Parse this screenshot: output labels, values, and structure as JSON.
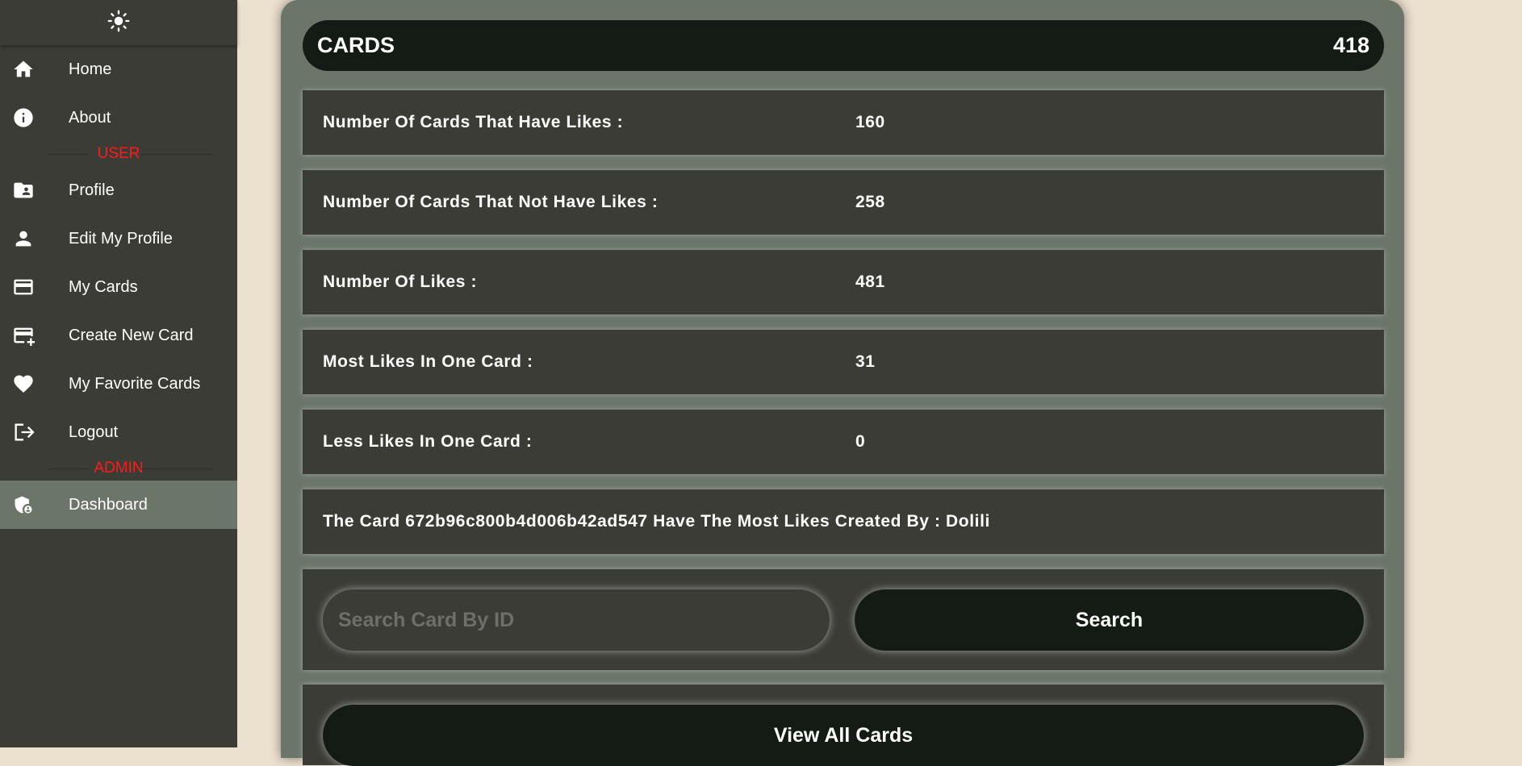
{
  "sidebar": {
    "theme_icon": "sun-icon",
    "items_user_top": [
      {
        "label": "Home",
        "icon": "home-icon"
      },
      {
        "label": "About",
        "icon": "info-icon"
      }
    ],
    "user_section_label": "USER",
    "items_user": [
      {
        "label": "Profile",
        "icon": "profile-folder-icon"
      },
      {
        "label": "Edit My Profile",
        "icon": "person-icon"
      },
      {
        "label": "My Cards",
        "icon": "card-icon"
      },
      {
        "label": "Create New Card",
        "icon": "add-card-icon"
      },
      {
        "label": "My Favorite Cards",
        "icon": "heart-icon"
      },
      {
        "label": "Logout",
        "icon": "logout-icon"
      }
    ],
    "admin_section_label": "ADMIN",
    "items_admin": [
      {
        "label": "Dashboard",
        "icon": "admin-shield-icon",
        "active": true
      }
    ]
  },
  "cards_panel": {
    "title": "CARDS",
    "total": "418",
    "stats": [
      {
        "label": "Number Of Cards That Have Likes :",
        "value": "160"
      },
      {
        "label": "Number Of Cards That Not Have Likes :",
        "value": "258"
      },
      {
        "label": "Number Of Likes :",
        "value": "481"
      },
      {
        "label": "Most Likes In One Card :",
        "value": "31"
      },
      {
        "label": "Less Likes In One Card :",
        "value": "0"
      }
    ],
    "most_liked_text": "The Card 672b96c800b4d006b42ad547 Have The Most Likes Created By : Dolili",
    "search": {
      "placeholder": "Search Card By ID",
      "value": "",
      "button_label": "Search"
    },
    "view_all_label": "View All Cards"
  },
  "colors": {
    "page_bg": "#ece0cf",
    "sidebar_bg": "#3c3c37",
    "active_bg": "#6b7669",
    "panel_bg": "#6b7669",
    "dark_button": "#131b14",
    "section_label": "#ff1a1a"
  }
}
